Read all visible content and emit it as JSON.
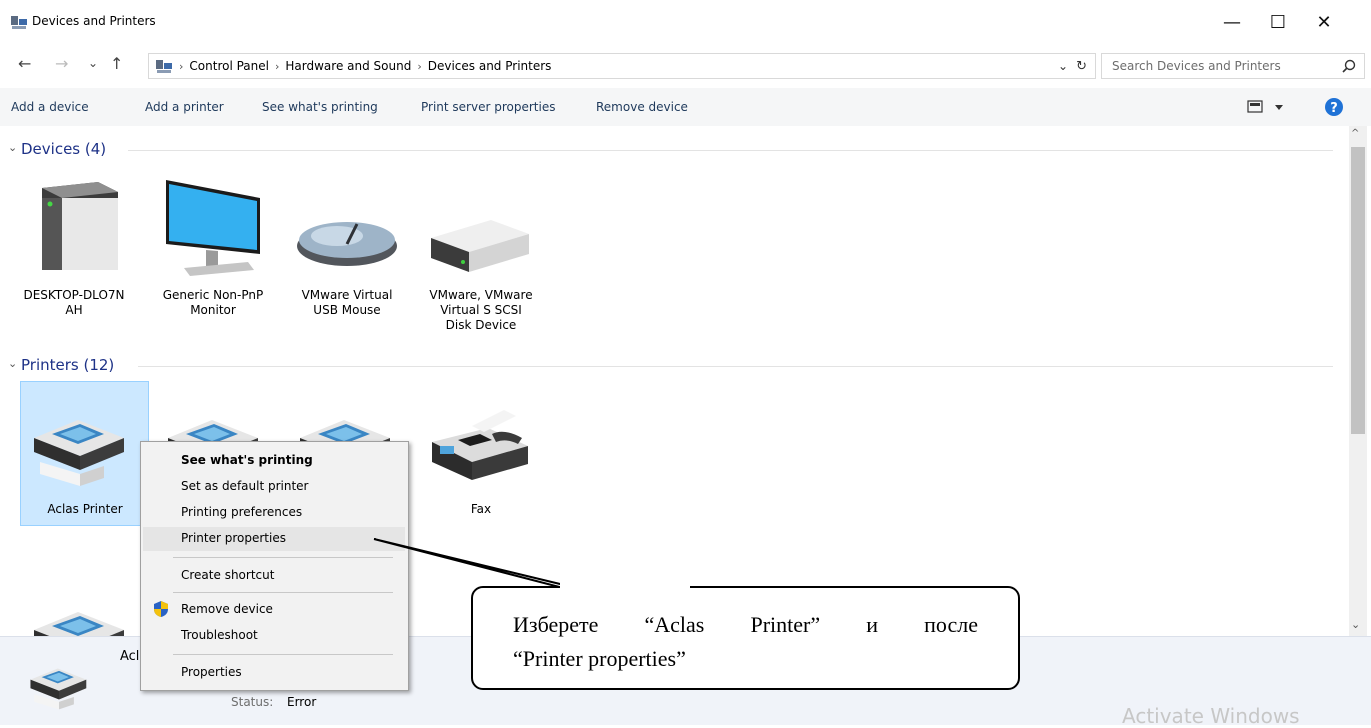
{
  "window": {
    "title": "Devices and Printers",
    "controls": {
      "minimize": "—",
      "maximize": "☐",
      "close": "✕"
    }
  },
  "nav": {
    "back": "←",
    "forward": "→",
    "recent": "⌄",
    "up": "↑",
    "breadcrumbs": [
      "Control Panel",
      "Hardware and Sound",
      "Devices and Printers"
    ],
    "search_placeholder": "Search Devices and Printers"
  },
  "commands": [
    "Add a device",
    "Add a printer",
    "See what's printing",
    "Print server properties",
    "Remove device"
  ],
  "groups": {
    "devices": {
      "header": "Devices (4)",
      "items": [
        {
          "name": "DESKTOP-DLO7N\nAH",
          "icon": "computer-tower-icon"
        },
        {
          "name": "Generic Non-PnP Monitor",
          "icon": "monitor-icon"
        },
        {
          "name": "VMware Virtual USB Mouse",
          "icon": "mouse-icon"
        },
        {
          "name": "VMware, VMware Virtual S SCSI Disk Device",
          "icon": "disk-drive-icon"
        }
      ]
    },
    "printers": {
      "header": "Printers (12)",
      "items": [
        {
          "name": "Aclas Printer",
          "icon": "printer-icon",
          "selected": true
        },
        {
          "name": "",
          "icon": "printer-icon"
        },
        {
          "name": "",
          "icon": "printer-icon"
        },
        {
          "name": "Fax",
          "icon": "fax-icon"
        },
        {
          "name": "",
          "icon": "printer-icon"
        }
      ]
    }
  },
  "context_menu": {
    "items": [
      {
        "label": "See what's printing",
        "bold": true
      },
      {
        "label": "Set as default printer"
      },
      {
        "label": "Printing preferences"
      },
      {
        "label": "Printer properties",
        "highlighted": true
      },
      {
        "label": "Create shortcut"
      },
      {
        "label": "Remove device",
        "icon": "shield-icon"
      },
      {
        "label": "Troubleshoot"
      },
      {
        "label": "Properties"
      }
    ]
  },
  "details_pane": {
    "name_partial": "Acl",
    "status_label": "Status:",
    "status_value": "Error"
  },
  "callout": {
    "text_line1": "Изберете “Aclas Printer” и после",
    "text_line2": "“Printer properties”"
  },
  "watermark": "Activate Windows",
  "colors": {
    "accent": "#1e395b",
    "group_header": "#1e3287",
    "selection": "#cce8ff"
  }
}
